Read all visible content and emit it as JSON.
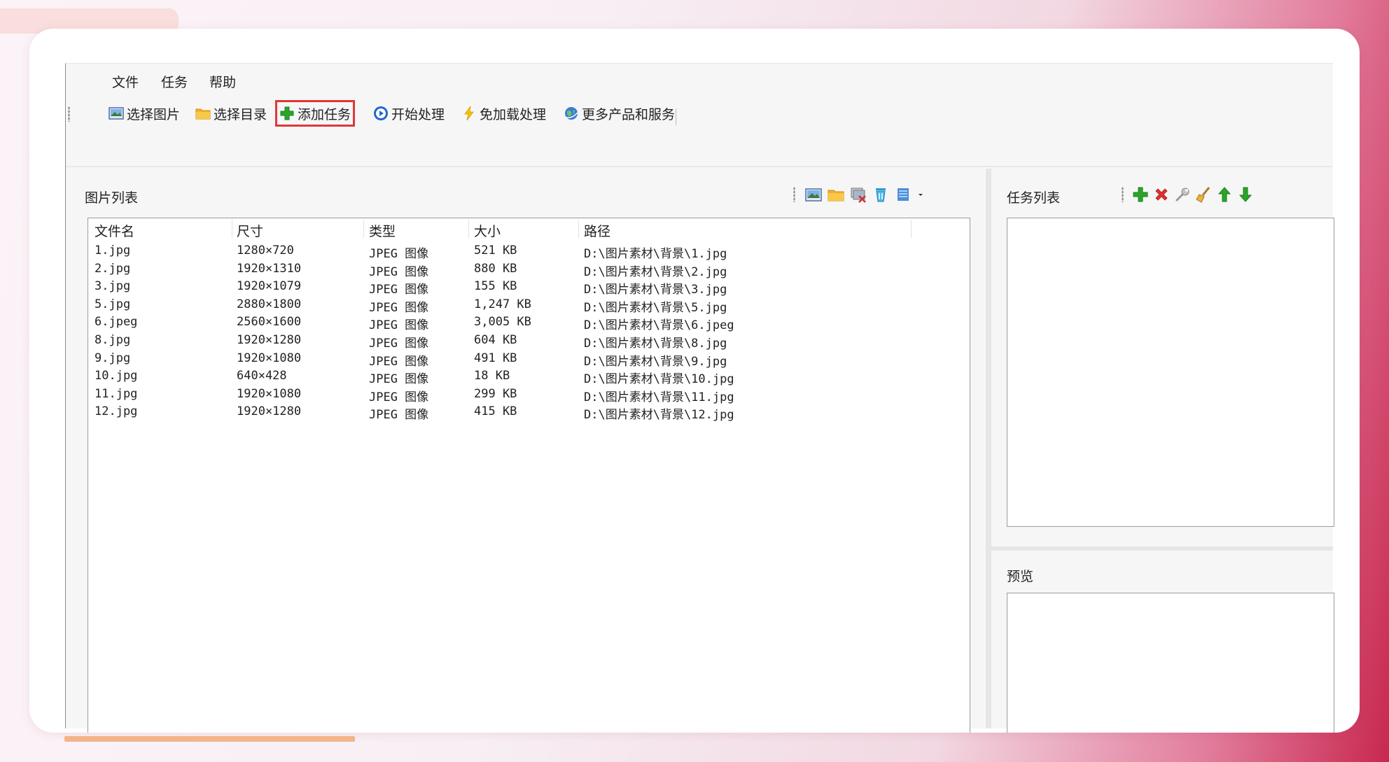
{
  "menu": [
    "文件",
    "任务",
    "帮助"
  ],
  "toolbar": {
    "buttons": [
      {
        "label": "选择图片",
        "icon": "picture-icon"
      },
      {
        "label": "选择目录",
        "icon": "folder-icon"
      },
      {
        "label": "添加任务",
        "icon": "plus-icon",
        "highlighted": true
      },
      {
        "label": "开始处理",
        "icon": "play-icon"
      },
      {
        "label": "免加载处理",
        "icon": "lightning-icon"
      },
      {
        "label": "更多产品和服务",
        "icon": "globe-icon"
      }
    ]
  },
  "image_list": {
    "title": "图片列表",
    "tools": [
      "picture-icon",
      "folder-icon",
      "remove-images-icon",
      "recycle-bin-icon",
      "view-list-icon",
      "dropdown-arrow-icon"
    ],
    "columns": [
      "文件名",
      "尺寸",
      "类型",
      "大小",
      "路径"
    ],
    "rows": [
      [
        "1.jpg",
        "1280×720",
        "JPEG 图像",
        "521 KB",
        "D:\\图片素材\\背景\\1.jpg"
      ],
      [
        "2.jpg",
        "1920×1310",
        "JPEG 图像",
        "880 KB",
        "D:\\图片素材\\背景\\2.jpg"
      ],
      [
        "3.jpg",
        "1920×1079",
        "JPEG 图像",
        "155 KB",
        "D:\\图片素材\\背景\\3.jpg"
      ],
      [
        "5.jpg",
        "2880×1800",
        "JPEG 图像",
        "1,247 KB",
        "D:\\图片素材\\背景\\5.jpg"
      ],
      [
        "6.jpeg",
        "2560×1600",
        "JPEG 图像",
        "3,005 KB",
        "D:\\图片素材\\背景\\6.jpeg"
      ],
      [
        "8.jpg",
        "1920×1280",
        "JPEG 图像",
        "604 KB",
        "D:\\图片素材\\背景\\8.jpg"
      ],
      [
        "9.jpg",
        "1920×1080",
        "JPEG 图像",
        "491 KB",
        "D:\\图片素材\\背景\\9.jpg"
      ],
      [
        "10.jpg",
        "640×428",
        "JPEG 图像",
        "18 KB",
        "D:\\图片素材\\背景\\10.jpg"
      ],
      [
        "11.jpg",
        "1920×1080",
        "JPEG 图像",
        "299 KB",
        "D:\\图片素材\\背景\\11.jpg"
      ],
      [
        "12.jpg",
        "1920×1280",
        "JPEG 图像",
        "415 KB",
        "D:\\图片素材\\背景\\12.jpg"
      ]
    ]
  },
  "task_list": {
    "title": "任务列表",
    "tools": [
      "add-task-icon",
      "delete-task-icon",
      "edit-task-icon",
      "clear-tasks-icon",
      "move-up-icon",
      "move-down-icon"
    ]
  },
  "preview": {
    "title": "预览"
  },
  "colors": {
    "highlight_border": "#e23737",
    "green": "#2aa52a",
    "red": "#e03030",
    "blue": "#2266cc"
  }
}
